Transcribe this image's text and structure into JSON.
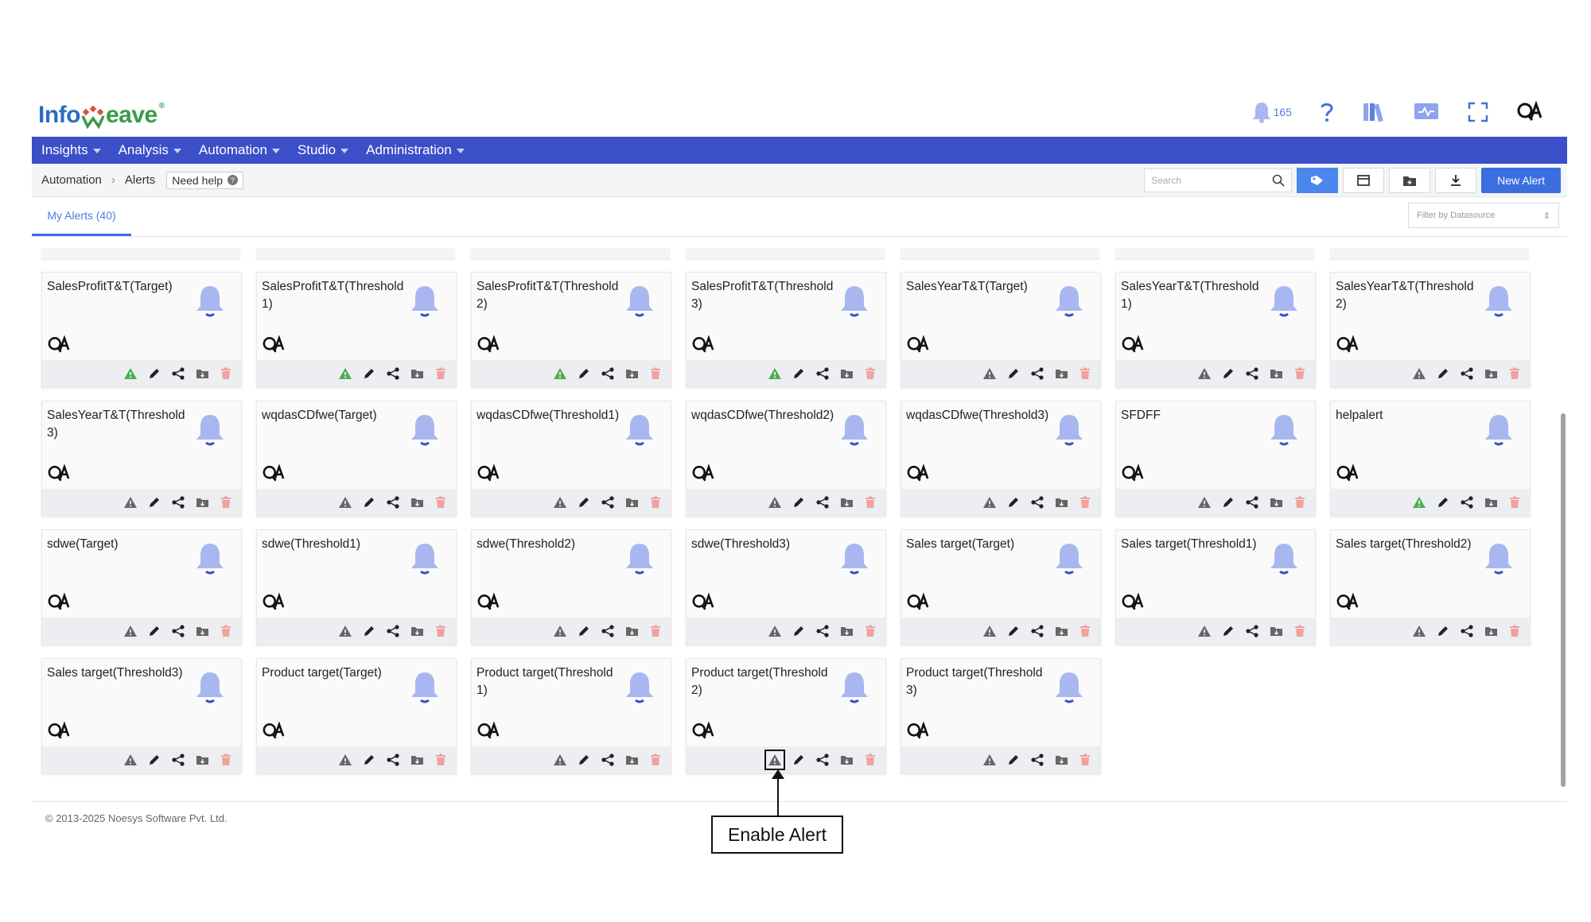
{
  "brand": {
    "prefix": "Info",
    "suffix": "eave",
    "mark": "w"
  },
  "header": {
    "notification_count": "165",
    "icons": [
      "bell-icon",
      "help-icon",
      "library-icon",
      "monitor-icon",
      "fullscreen-icon",
      "qa-avatar-icon"
    ]
  },
  "nav": {
    "items": [
      {
        "label": "Insights"
      },
      {
        "label": "Analysis"
      },
      {
        "label": "Automation"
      },
      {
        "label": "Studio"
      },
      {
        "label": "Administration"
      }
    ]
  },
  "breadcrumb": {
    "items": [
      "Automation",
      "Alerts"
    ],
    "help": "Need help"
  },
  "toolbar": {
    "search_placeholder": "Search",
    "new_alert": "New Alert"
  },
  "tabs": {
    "my_alerts": "My Alerts (40)"
  },
  "filter": {
    "placeholder": "Filter by Datasource"
  },
  "avatar_text": "QA",
  "cards": [
    {
      "title": "SalesProfitT&T(Target)",
      "enabled": true
    },
    {
      "title": "SalesProfitT&T(Threshold1)",
      "enabled": true
    },
    {
      "title": "SalesProfitT&T(Threshold2)",
      "enabled": true
    },
    {
      "title": "SalesProfitT&T(Threshold3)",
      "enabled": true
    },
    {
      "title": "SalesYearT&T(Target)",
      "enabled": false
    },
    {
      "title": "SalesYearT&T(Threshold1)",
      "enabled": false
    },
    {
      "title": "SalesYearT&T(Threshold2)",
      "enabled": false
    },
    {
      "title": "SalesYearT&T(Threshold3)",
      "enabled": false
    },
    {
      "title": "wqdasCDfwe(Target)",
      "enabled": false
    },
    {
      "title": "wqdasCDfwe(Threshold1)",
      "enabled": false
    },
    {
      "title": "wqdasCDfwe(Threshold2)",
      "enabled": false
    },
    {
      "title": "wqdasCDfwe(Threshold3)",
      "enabled": false
    },
    {
      "title": "SFDFF",
      "enabled": false
    },
    {
      "title": "helpalert",
      "enabled": true
    },
    {
      "title": "sdwe(Target)",
      "enabled": false
    },
    {
      "title": "sdwe(Threshold1)",
      "enabled": false
    },
    {
      "title": "sdwe(Threshold2)",
      "enabled": false
    },
    {
      "title": "sdwe(Threshold3)",
      "enabled": false
    },
    {
      "title": "Sales target(Target)",
      "enabled": false
    },
    {
      "title": "Sales target(Threshold1)",
      "enabled": false
    },
    {
      "title": "Sales target(Threshold2)",
      "enabled": false
    },
    {
      "title": "Sales target(Threshold3)",
      "enabled": false
    },
    {
      "title": "Product target(Target)",
      "enabled": false
    },
    {
      "title": "Product target(Threshold1)",
      "enabled": false
    },
    {
      "title": "Product target(Threshold2)",
      "enabled": false,
      "highlighted": true
    },
    {
      "title": "Product target(Threshold3)",
      "enabled": false
    }
  ],
  "colors": {
    "nav_bg": "#3b4fc8",
    "bell": "#a9b7f0",
    "enabled_warn": "#4caf50",
    "disabled_warn": "#666666",
    "delete": "#f2a0a0"
  },
  "footer": {
    "copyright": "© 2013-2025 Noesys Software Pvt. Ltd."
  },
  "annotation": {
    "label": "Enable Alert"
  }
}
